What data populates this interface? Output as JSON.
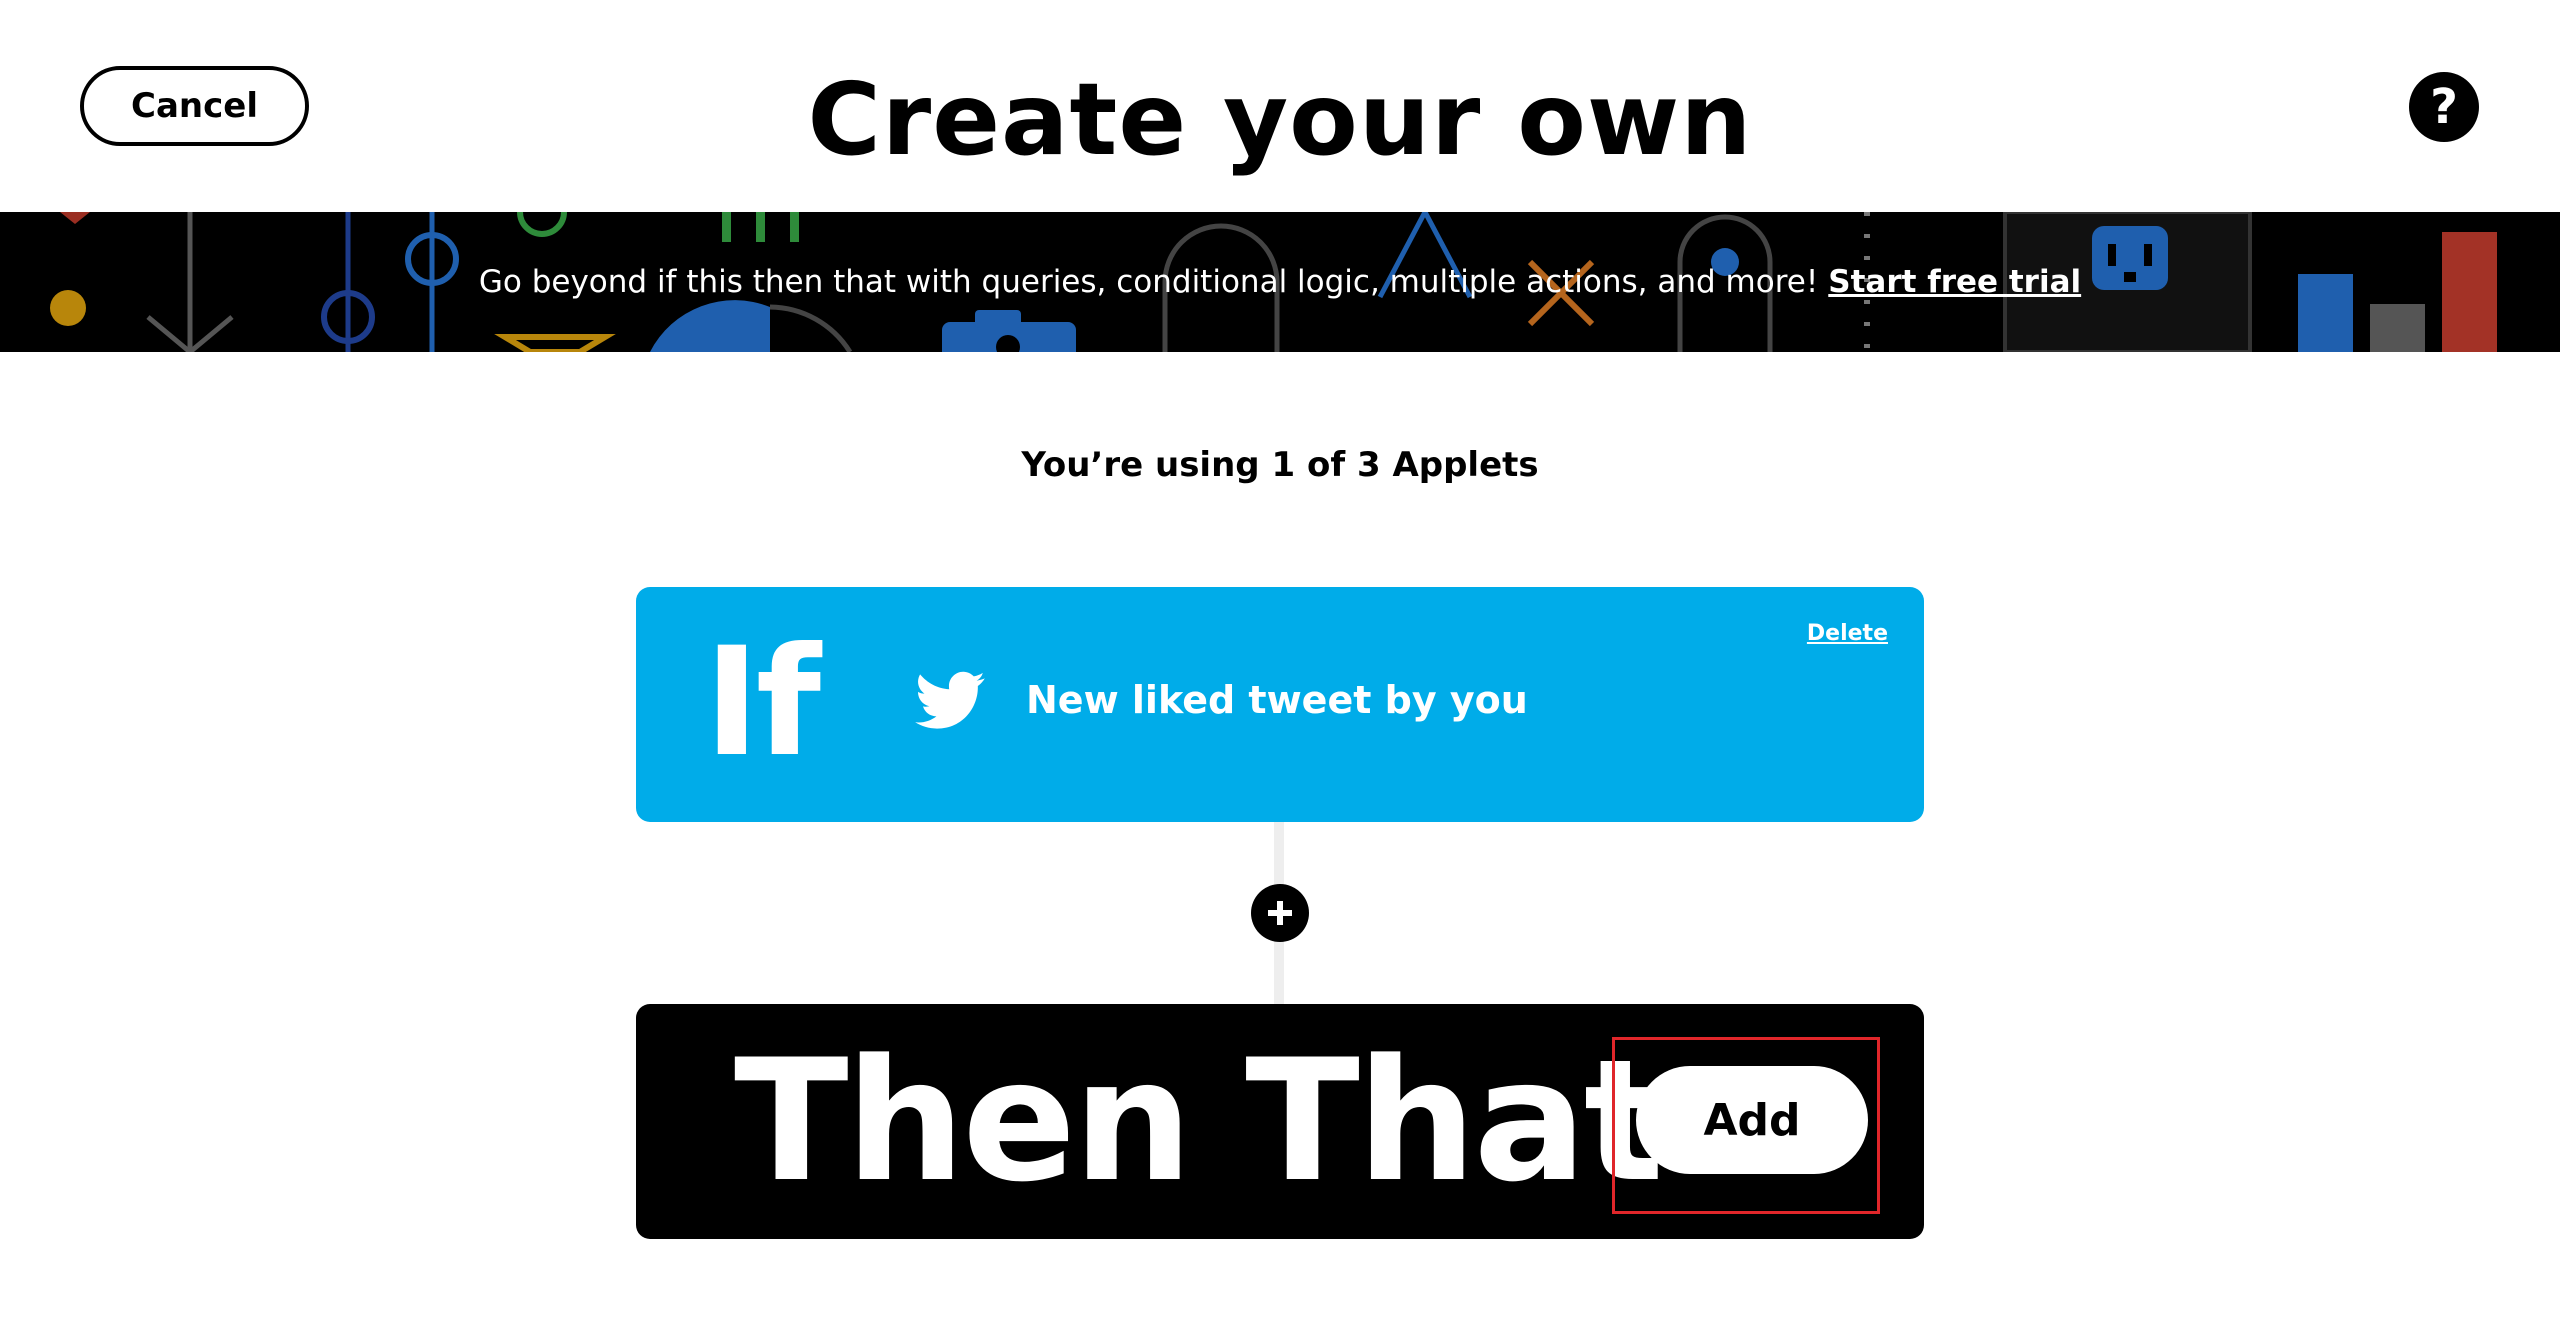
{
  "header": {
    "cancel_label": "Cancel",
    "title": "Create your own",
    "help_label": "?"
  },
  "banner": {
    "text": "Go beyond if this then that with queries, conditional logic, multiple actions, and more!",
    "link_label": "Start free trial"
  },
  "usage": {
    "text": "You’re using 1 of 3 Applets"
  },
  "if_card": {
    "keyword": "If",
    "trigger_label": "New liked tweet by you",
    "delete_label": "Delete",
    "service_icon": "twitter-icon",
    "color": "#00ace9"
  },
  "connector": {
    "plus_icon": "plus-icon"
  },
  "then_card": {
    "keyword": "Then That",
    "add_label": "Add",
    "highlight_color": "#e0262a"
  }
}
